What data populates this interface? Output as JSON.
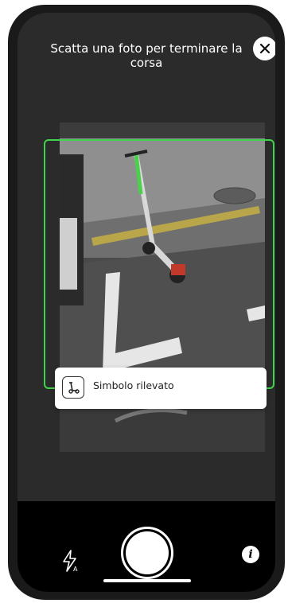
{
  "header": {
    "title": "Scatta una foto per terminare la corsa"
  },
  "detection_toast": {
    "text": "Simbolo rilevato",
    "icon": "scooter-icon"
  },
  "frame": {
    "color": "#3cd44a"
  },
  "controls": {
    "flash_icon": "flash-auto-icon",
    "shutter_icon": "shutter-button",
    "info_icon": "info-icon",
    "close_icon": "close-icon"
  }
}
